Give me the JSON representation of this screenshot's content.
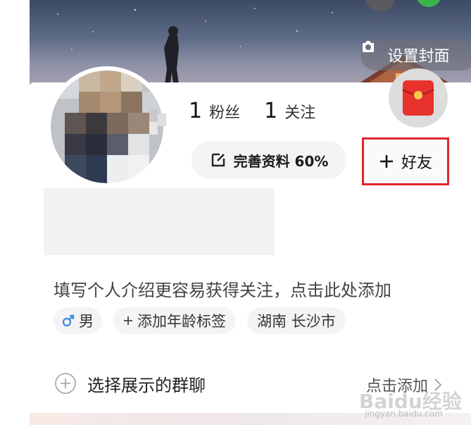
{
  "profile": {
    "cover_button_label": "设置封面",
    "followers": {
      "count": "1",
      "label": "粉丝"
    },
    "following": {
      "count": "1",
      "label": "关注"
    },
    "complete_profile_label": "完善资料 60%",
    "add_friend_label": "好友",
    "bio_prompt": "填写个人介绍更容易获得关注，点击此处添加",
    "tags": [
      {
        "label": "男"
      },
      {
        "label": "添加年龄标签"
      },
      {
        "label": "湖南 长沙市"
      }
    ],
    "group_section": {
      "title": "选择展示的群聊",
      "action": "点击添加"
    },
    "watermark": {
      "text": "Baidu经验",
      "sub": "jingyan.baidu.com"
    }
  },
  "colors": {
    "highlight": "#e0262b",
    "red_packet": "#e8322e",
    "male": "#3a86e0"
  },
  "icons": [
    "camera-icon",
    "edit-icon",
    "plus-icon",
    "red-packet-icon",
    "male-icon",
    "add-circle-icon",
    "chevron-right-icon"
  ]
}
